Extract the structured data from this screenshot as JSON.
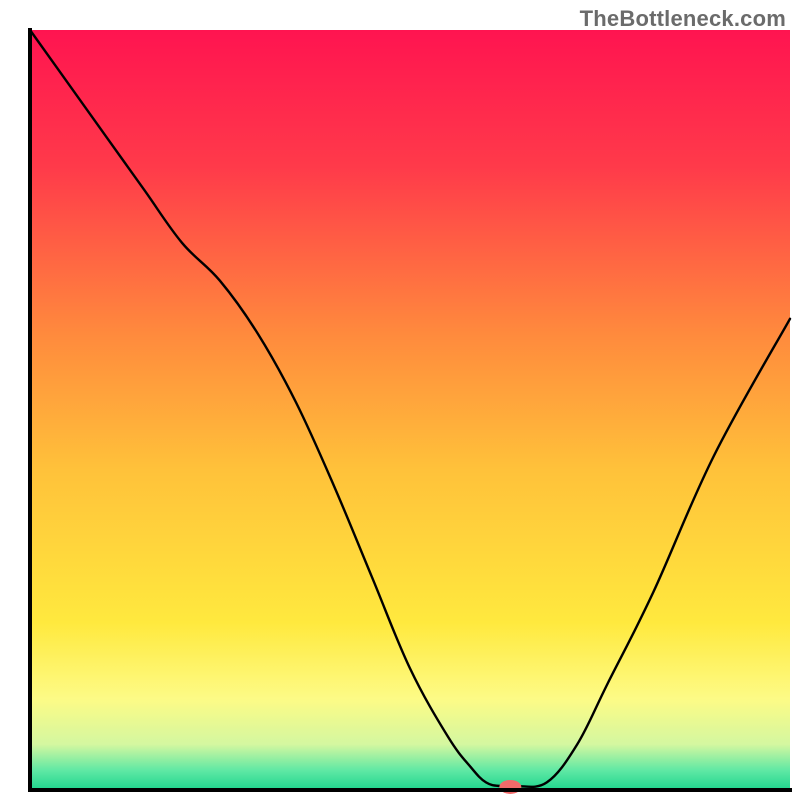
{
  "watermark": "TheBottleneck.com",
  "chart_data": {
    "type": "line",
    "title": "",
    "xlabel": "",
    "ylabel": "",
    "xlim": [
      0,
      100
    ],
    "ylim": [
      0,
      100
    ],
    "axes": {
      "color": "#000000",
      "width": 3
    },
    "background_gradient_stops": [
      {
        "pos": 0.0,
        "color": "#ff1450"
      },
      {
        "pos": 0.18,
        "color": "#ff3a4a"
      },
      {
        "pos": 0.4,
        "color": "#ff8a3d"
      },
      {
        "pos": 0.58,
        "color": "#ffc23a"
      },
      {
        "pos": 0.78,
        "color": "#ffe93e"
      },
      {
        "pos": 0.88,
        "color": "#fdfb86"
      },
      {
        "pos": 0.94,
        "color": "#d4f7a0"
      },
      {
        "pos": 0.975,
        "color": "#5de8a4"
      },
      {
        "pos": 1.0,
        "color": "#1fd58d"
      }
    ],
    "series": [
      {
        "name": "bottleneck-curve",
        "x": [
          0,
          5,
          10,
          15,
          20,
          25,
          30,
          35,
          40,
          45,
          50,
          55,
          58,
          60,
          62,
          64,
          68,
          72,
          76,
          82,
          90,
          100
        ],
        "y": [
          100,
          93,
          86,
          79,
          72,
          67,
          60,
          51,
          40,
          28,
          16,
          7,
          3,
          1,
          0.5,
          0.5,
          1,
          6,
          14,
          26,
          44,
          62
        ]
      }
    ],
    "marker": {
      "name": "optimum-marker",
      "x": 63.2,
      "y": 0.4,
      "color": "#f06a6a",
      "rx": 11,
      "ry": 7
    }
  }
}
